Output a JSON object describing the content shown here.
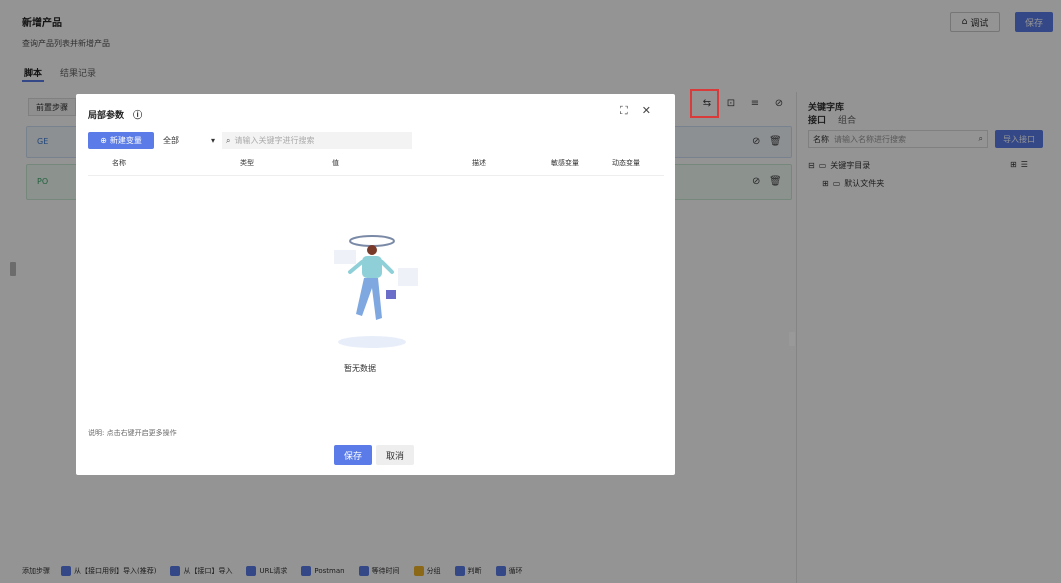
{
  "header": {
    "title": "新增产品",
    "subtitle": "查询产品列表并新增产品",
    "debug_label": "调试",
    "save_label": "保存"
  },
  "tabs": [
    {
      "label": "脚本"
    },
    {
      "label": "结果记录"
    }
  ],
  "editor": {
    "pre_step_tab": "前置步骤",
    "steps": [
      {
        "method": "GE"
      },
      {
        "method": "PO"
      }
    ]
  },
  "right_panel": {
    "title": "关键字库",
    "tabs": [
      "接口",
      "组合"
    ],
    "search_prefix": "名称",
    "search_placeholder": "请输入名称进行搜索",
    "import_label": "导入接口",
    "tree": {
      "root": "关键字目录",
      "child": "默认文件夹"
    }
  },
  "bottom_bar": {
    "label": "添加步骤",
    "items": [
      "从【接口用例】导入(推荐)",
      "从【接口】导入",
      "URL请求",
      "Postman",
      "等待时间",
      "分组",
      "判断",
      "循环"
    ]
  },
  "modal": {
    "title": "局部参数",
    "new_button": "新建变量",
    "filter_value": "全部",
    "search_placeholder": "请输入关键字进行搜索",
    "columns": [
      "名称",
      "类型",
      "值",
      "描述",
      "敏感变量",
      "动态变量"
    ],
    "empty_text": "暂无数据",
    "note": "说明: 点击右键开启更多操作",
    "save_label": "保存",
    "cancel_label": "取消"
  }
}
